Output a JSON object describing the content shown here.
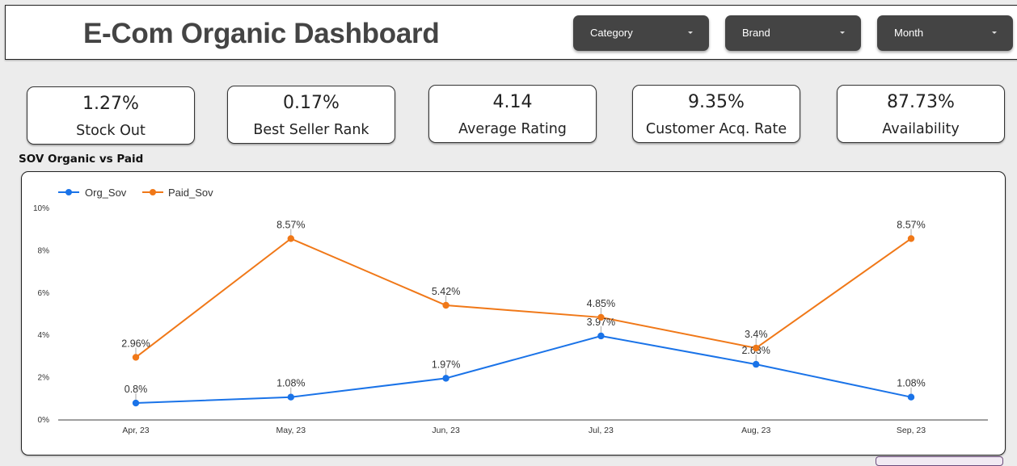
{
  "header": {
    "title": "E-Com Organic Dashboard",
    "filters": [
      {
        "label": "Category",
        "icon": "caret-down-icon"
      },
      {
        "label": "Brand",
        "icon": "caret-down-icon"
      },
      {
        "label": "Month",
        "icon": "caret-down-icon"
      }
    ]
  },
  "kpis": [
    {
      "value": "1.27%",
      "label": "Stock Out"
    },
    {
      "value": "0.17%",
      "label": "Best Seller Rank"
    },
    {
      "value": "4.14",
      "label": "Average Rating"
    },
    {
      "value": "9.35%",
      "label": "Customer Acq. Rate"
    },
    {
      "value": "87.73%",
      "label": "Availability"
    }
  ],
  "section_title": "SOV  Organic vs Paid",
  "colors": {
    "org": "#1a73e8",
    "paid": "#f07818",
    "axis": "#666666",
    "tick_text": "#333333"
  },
  "chart_data": {
    "type": "line",
    "title": "SOV  Organic vs Paid",
    "xlabel": "",
    "ylabel": "",
    "categories": [
      "Apr, 23",
      "May, 23",
      "Jun, 23",
      "Jul, 23",
      "Aug, 23",
      "Sep, 23"
    ],
    "ylim": [
      0,
      10
    ],
    "yticks": [
      0,
      2,
      4,
      6,
      8,
      10
    ],
    "ytick_labels": [
      "0%",
      "2%",
      "4%",
      "6%",
      "8%",
      "10%"
    ],
    "grid": false,
    "legend": "top-left",
    "series": [
      {
        "name": "Org_Sov",
        "values": [
          0.8,
          1.08,
          1.97,
          3.97,
          2.63,
          1.08
        ],
        "labels": [
          "0.8%",
          "1.08%",
          "1.97%",
          "3.97%",
          "2.63%",
          "1.08%"
        ]
      },
      {
        "name": "Paid_Sov",
        "values": [
          2.96,
          8.57,
          5.42,
          4.85,
          3.4,
          8.57
        ],
        "labels": [
          "2.96%",
          "8.57%",
          "5.42%",
          "4.85%",
          "3.4%",
          "8.57%"
        ]
      }
    ]
  }
}
